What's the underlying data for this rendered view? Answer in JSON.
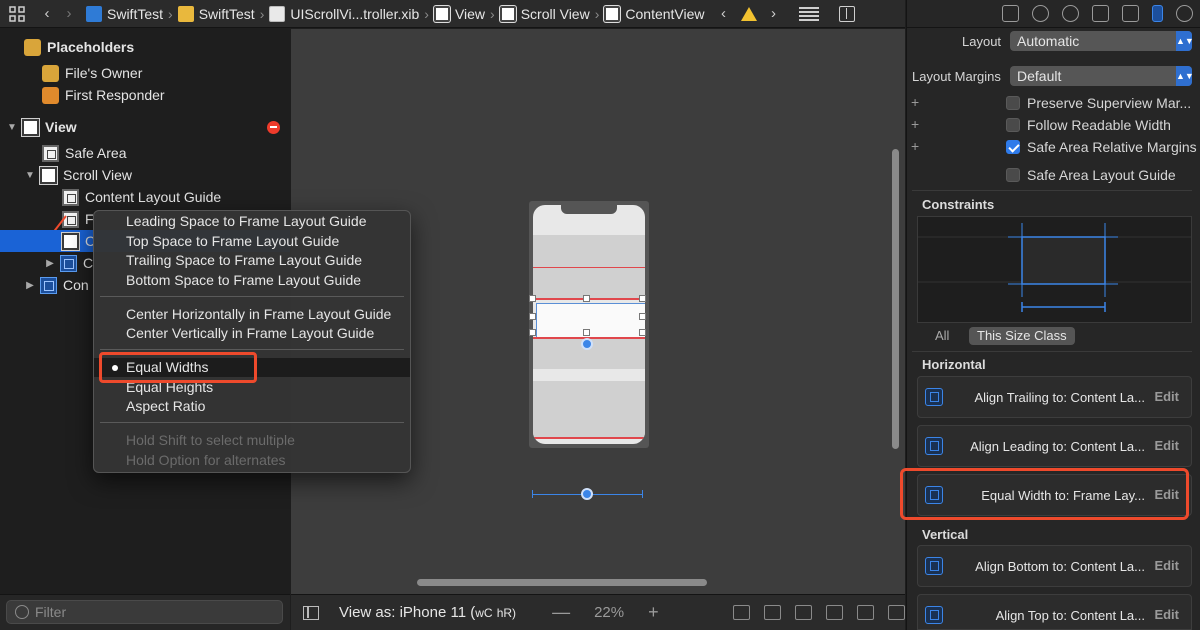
{
  "jumpbar": {
    "crumbs": [
      {
        "icon": "swift-project-icon",
        "label": "SwiftTest"
      },
      {
        "icon": "folder-icon",
        "label": "SwiftTest"
      },
      {
        "icon": "xib-file-icon",
        "label": "UIScrollVi...troller.xib"
      },
      {
        "icon": "view-icon",
        "label": "View"
      },
      {
        "icon": "view-icon",
        "label": "Scroll View"
      },
      {
        "icon": "view-icon",
        "label": "ContentView"
      }
    ]
  },
  "outline": {
    "rows": [
      {
        "label": "Placeholders",
        "icon": "placeholder-cube-icon",
        "bold": true
      },
      {
        "label": "File's Owner",
        "icon": "cube-icon"
      },
      {
        "label": "First Responder",
        "icon": "first-responder-icon"
      },
      {
        "label": "View",
        "icon": "view-icon",
        "bold": true
      },
      {
        "label": "Safe Area",
        "icon": "safe-area-icon"
      },
      {
        "label": "Scroll View",
        "icon": "view-icon"
      },
      {
        "label": "Content Layout Guide",
        "icon": "layout-guide-icon"
      },
      {
        "label": "F",
        "icon": "layout-guide-icon"
      },
      {
        "label": "C",
        "icon": "view-icon"
      },
      {
        "label": "C",
        "icon": "constraints-icon"
      },
      {
        "label": "Con",
        "icon": "constraints-icon"
      }
    ],
    "filter_placeholder": "Filter"
  },
  "menu": {
    "items": [
      "Leading Space to Frame Layout Guide",
      "Top Space to Frame Layout Guide",
      "Trailing Space to Frame Layout Guide",
      "Bottom Space to Frame Layout Guide",
      "Center Horizontally in Frame Layout Guide",
      "Center Vertically in Frame Layout Guide",
      "Equal Widths",
      "Equal Heights",
      "Aspect Ratio",
      "Hold Shift to select multiple",
      "Hold Option for alternates"
    ]
  },
  "canvas_bar": {
    "view_as": "View as: iPhone 11 (",
    "size_class_w": "wC",
    "size_class_h": "hR)",
    "zoom_out": "—",
    "zoom": "22%",
    "zoom_in": "+"
  },
  "inspector": {
    "layout_label": "Layout",
    "layout_value": "Automatic",
    "margins_label": "Layout Margins",
    "margins_value": "Default",
    "checkboxes": [
      {
        "label": "Preserve Superview Mar...",
        "checked": false
      },
      {
        "label": "Follow Readable Width",
        "checked": false
      },
      {
        "label": "Safe Area Relative Margins",
        "checked": true
      },
      {
        "label": "Safe Area Layout Guide",
        "checked": false
      }
    ],
    "constraints_label": "Constraints",
    "seg_all": "All",
    "seg_size_class": "This Size Class",
    "horizontal_label": "Horizontal",
    "vertical_label": "Vertical",
    "horizontal_constraints": [
      {
        "text": "Align Trailing to:  Content La...",
        "edit": "Edit"
      },
      {
        "text": "Align Leading to:  Content La...",
        "edit": "Edit"
      },
      {
        "text": "Equal Width to:  Frame Lay...",
        "edit": "Edit"
      }
    ],
    "vertical_constraints": [
      {
        "text": "Align Bottom to:  Content La...",
        "edit": "Edit"
      },
      {
        "text": "Align Top to:  Content La...",
        "edit": "Edit"
      }
    ]
  },
  "colors": {
    "selection": "#1a63d6",
    "callout": "#ee4a2c",
    "accent": "#3b85e8",
    "error": "#ee3b2b"
  }
}
